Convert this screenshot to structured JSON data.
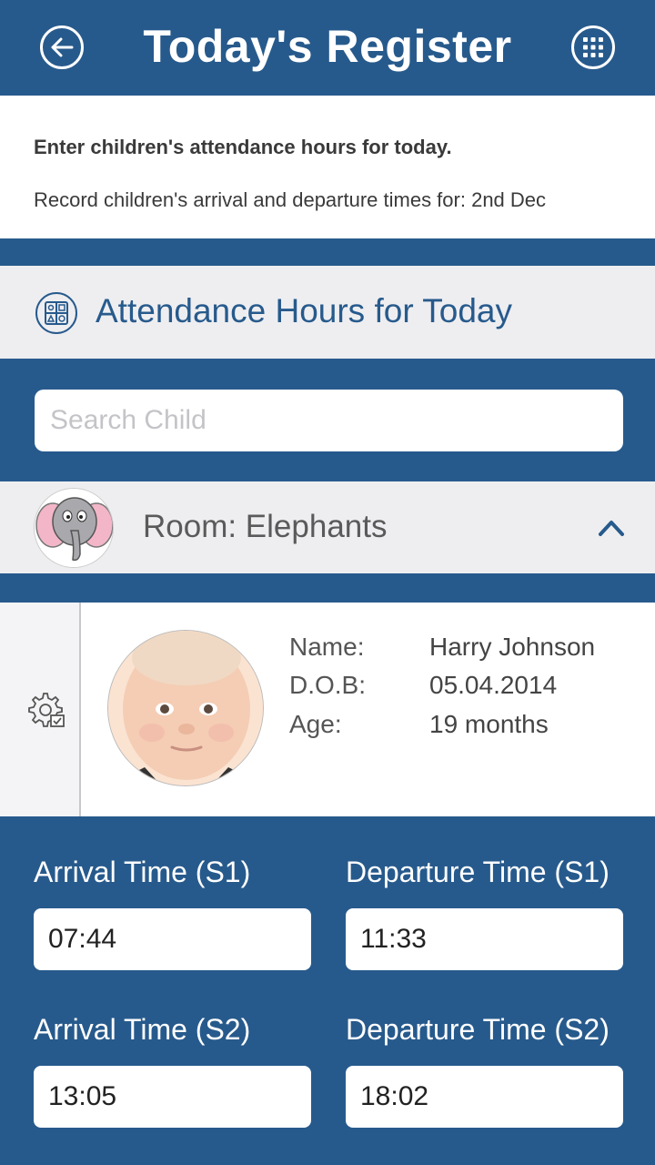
{
  "header": {
    "title": "Today's Register",
    "back_icon": "back-arrow-icon",
    "menu_icon": "grid-menu-icon"
  },
  "intro": {
    "instruction": "Enter children's attendance hours for today.",
    "record_text": "Record children's arrival and departure times for: 2nd Dec"
  },
  "section": {
    "title": "Attendance Hours for Today",
    "icon": "attendance-grid-icon"
  },
  "search": {
    "placeholder": "Search Child",
    "value": ""
  },
  "room": {
    "label": "Room: Elephants",
    "avatar_icon": "elephant-avatar",
    "toggle_icon": "chevron-up-icon"
  },
  "child": {
    "name_label": "Name:",
    "name": "Harry Johnson",
    "dob_label": "D.O.B:",
    "dob": "05.04.2014",
    "age_label": "Age:",
    "age": "19 months"
  },
  "times": {
    "arrival_s1_label": "Arrival Time (S1)",
    "arrival_s1": "07:44",
    "departure_s1_label": "Departure Time (S1)",
    "departure_s1": "11:33",
    "arrival_s2_label": "Arrival Time (S2)",
    "arrival_s2": "13:05",
    "departure_s2_label": "Departure Time (S2)",
    "departure_s2": "18:02"
  },
  "colors": {
    "brand": "#275a8c",
    "panel": "#eeeef1",
    "white": "#ffffff"
  }
}
